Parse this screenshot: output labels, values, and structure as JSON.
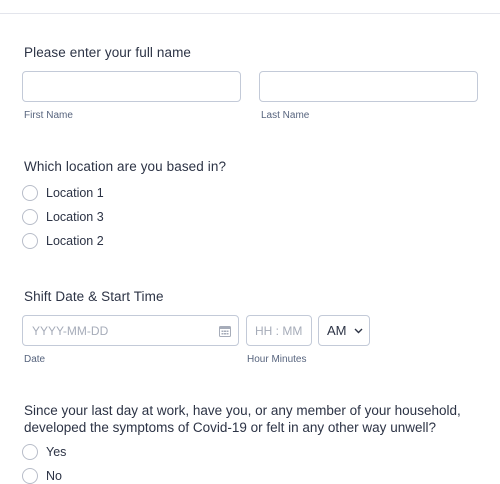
{
  "name_section": {
    "label": "Please enter your full name",
    "first_label": "First Name",
    "last_label": "Last Name"
  },
  "location_section": {
    "label": "Which location are you based in?",
    "options": [
      "Location 1",
      "Location 3",
      "Location 2"
    ]
  },
  "shift_section": {
    "label": "Shift Date & Start Time",
    "date_placeholder": "YYYY-MM-DD",
    "time_placeholder": "HH : MM",
    "ampm_value": "AM",
    "date_sublabel": "Date",
    "time_sublabel": "Hour Minutes"
  },
  "covid_section": {
    "question": "Since your last day at work, have you, or any member of your household, developed the symptoms of Covid-19 or felt in any other way unwell?",
    "options": [
      "Yes",
      "No"
    ]
  }
}
